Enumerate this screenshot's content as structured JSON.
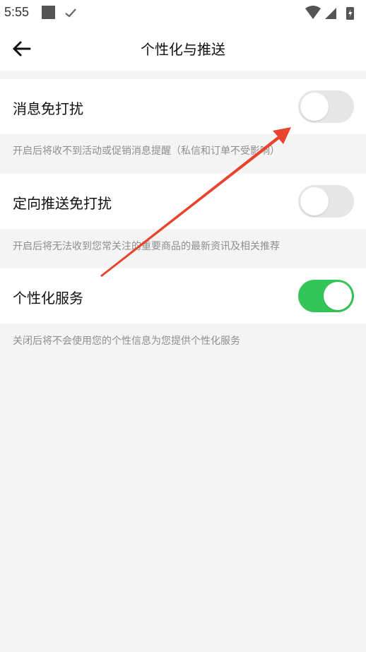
{
  "status_bar": {
    "time": "5:55",
    "icons": [
      "notification-square-icon",
      "check-icon",
      "wifi-icon",
      "signal-icon",
      "battery-charging-icon"
    ]
  },
  "header": {
    "title": "个性化与推送",
    "back_icon": "arrow-left-icon"
  },
  "settings": [
    {
      "label": "消息免打扰",
      "enabled": false,
      "description": "开启后将收不到活动或促销消息提醒（私信和订单不受影响）"
    },
    {
      "label": "定向推送免打扰",
      "enabled": false,
      "description": "开启后将无法收到您常关注的重要商品的最新资讯及相关推荐"
    },
    {
      "label": "个性化服务",
      "enabled": true,
      "description": "关闭后将不会使用您的个性信息为您提供个性化服务"
    }
  ],
  "colors": {
    "toggle_on": "#33c558",
    "toggle_off": "#e6e6e6",
    "annotation_arrow": "#e8432c",
    "background": "#f4f4f4"
  }
}
